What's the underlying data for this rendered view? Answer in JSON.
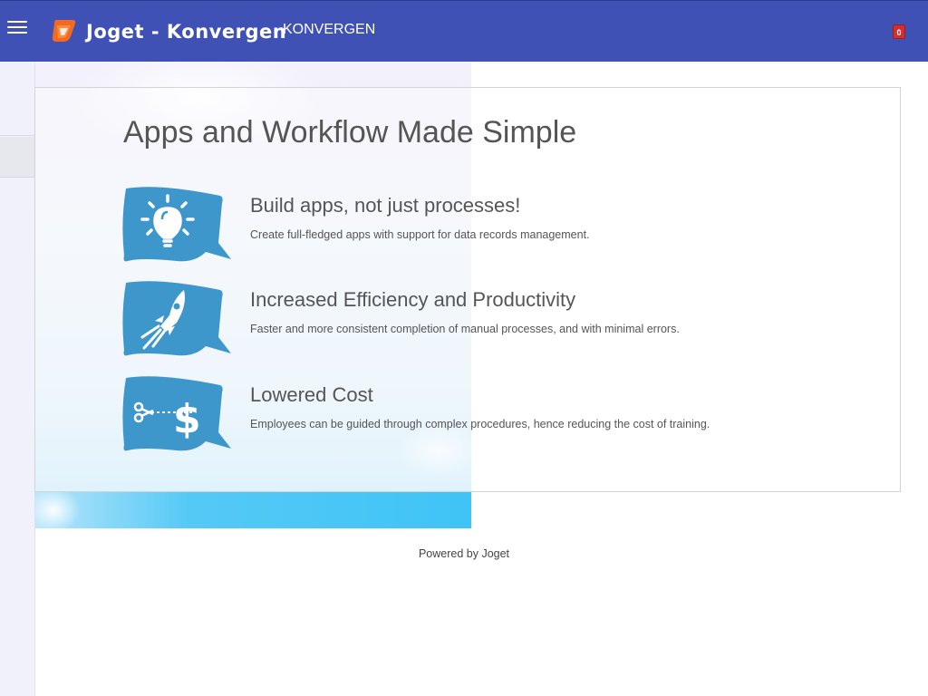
{
  "header": {
    "brand": "Joget - Konvergen",
    "app_name": "KONVERGEN",
    "notification_count": "0",
    "bg_color": "#3f51b5",
    "menu_icon": "hamburger-menu-icon",
    "logo_icon": "joget-logo-icon"
  },
  "main": {
    "title": "Apps and Workflow Made Simple",
    "features": [
      {
        "icon": "lightbulb-icon",
        "title": "Build apps, not just processes!",
        "description": "Create full-fledged apps with support for data records management."
      },
      {
        "icon": "rocket-icon",
        "title": "Increased Efficiency and Productivity",
        "description": "Faster and more consistent completion of manual processes, and with minimal errors."
      },
      {
        "icon": "scissors-dollar-icon",
        "title": "Lowered Cost",
        "description": "Employees can be guided through complex procedures, hence reducing the cost of training."
      }
    ],
    "bubble_color": "#3e97cb"
  },
  "footer": {
    "text": "Powered by Joget"
  }
}
